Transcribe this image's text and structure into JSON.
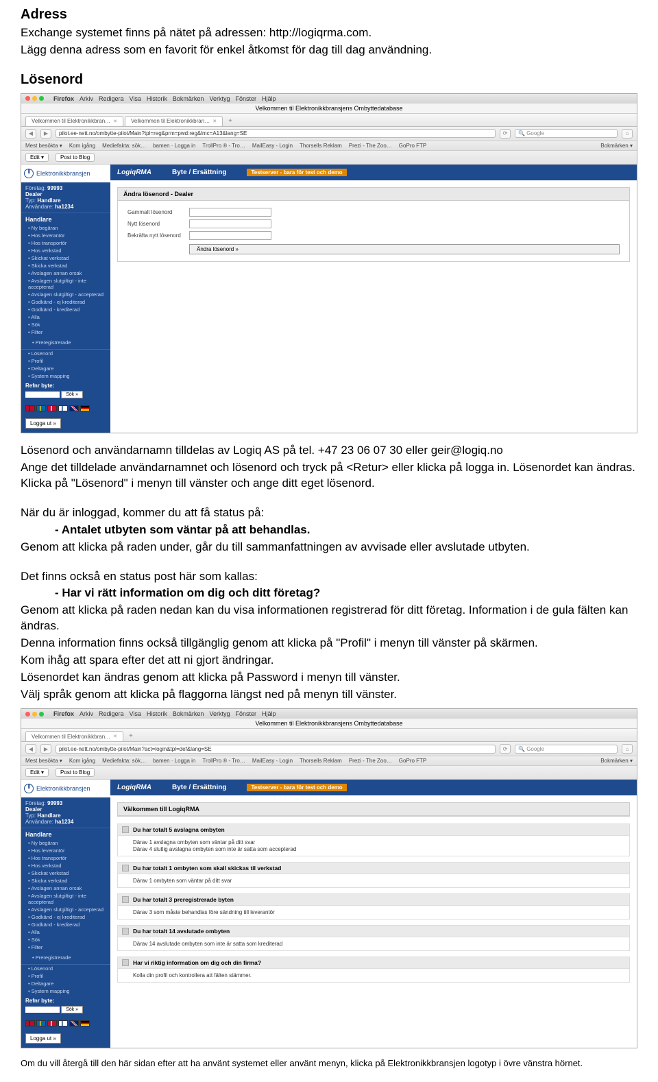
{
  "doc": {
    "adress_title": "Adress",
    "adress_p1": "Exchange systemet finns på nätet på adressen: http://logiqrma.com.",
    "adress_p2": "Lägg denna adress som en favorit för enkel åtkomst för dag till dag användning.",
    "losenord_title": "Lösenord",
    "middle_p1": "Lösenord och användarnamn tilldelas av Logiq AS på tel. +47 23 06 07 30 eller geir@logiq.no",
    "middle_p2": "Ange det tilldelade användarnamnet och lösenord och tryck på  <Retur>  eller klicka på logga in. Lösenordet kan ändras. Klicka på \"Lösenord\" i menyn till vänster och ange ditt eget lösenord.",
    "middle_p3": "När du är inloggad, kommer du att få status på:",
    "middle_b1": "- Antalet utbyten som väntar på att behandlas.",
    "middle_p4": "Genom att klicka på raden under, går du till sammanfattningen av avvisade eller avslutade utbyten.",
    "middle_p5": "Det finns också en status post här som kallas:",
    "middle_b2": "- Har vi rätt information om dig och ditt företag?",
    "middle_p6": "Genom att klicka på raden nedan kan du visa informationen registrerad för ditt företag. Information i de gula fälten kan ändras.",
    "middle_p7": "Denna information finns också tillgänglig genom att klicka på \"Profil\" i menyn till vänster på skärmen.",
    "middle_p8": "Kom ihåg att spara efter det att ni gjort ändringar.",
    "middle_p9": "Lösenordet kan ändras genom att klicka på Password i menyn till vänster.",
    "middle_p10": "Välj språk genom att klicka på flaggorna längst ned på menyn till vänster.",
    "footnote": "Om du vill återgå till den här sidan efter att ha använt systemet eller använt menyn, klicka på Elektronikkbransjen logotyp i övre vänstra hörnet."
  },
  "browser": {
    "app_name": "Firefox",
    "menu": [
      "Arkiv",
      "Redigera",
      "Visa",
      "Historik",
      "Bokmärken",
      "Verktyg",
      "Fönster",
      "Hjälp"
    ],
    "window_title": "Velkommen til Elektronikkbransjens Ombyttedatabase",
    "tab1": "Velkommen til Elektronikkbran…",
    "tab2": "Velkommen til Elektronikkbran…",
    "url1": "pilot.ee-nett.no/ombytte-pilot/Main?tpl=reg&prm=pwd:reg&lmc=A13&lang=SE",
    "url2": "pilot.ee-nett.no/ombytte-pilot/Main?act=login&tpl=def&lang=SE",
    "search_placeholder": "Google",
    "bookmarks": [
      "Mest besökta ▾",
      "Kom igång",
      "Mediefakta: sök…",
      "bamen · Logga in",
      "TrollPro ® - Tro…",
      "MailEasy - Login",
      "Thorsells Reklam",
      "Prezi - The Zoo…",
      "GoPro FTP"
    ],
    "bookmark_right": "Bokmärken ▾",
    "edit": "Edit ▾",
    "post_to_blog": "Post to Blog"
  },
  "app": {
    "logo_text": "Elektronikkbransjen",
    "brand": "LogiqRMA",
    "nav": "Byte / Ersättning",
    "test_banner": "Testserver - bara för test och demo",
    "sidebar": {
      "company_label": "Företag:",
      "company_value": "99993",
      "dealer_label": "Dealer",
      "type_label": "Typ:",
      "type_value": "Handlare",
      "user_label": "Användare:",
      "user_value": "ha1234",
      "section_handlare": "Handlare",
      "items": [
        "Ny begäran",
        "Hos leverantör",
        "Hos transportör",
        "Hos verkstad",
        "Skickat verkstad",
        "Skicka verkstad",
        "Avslagen annan orsak",
        "Avslagen slutgiltigt - inte accepterad",
        "Avslagen slutgiltigt - accepterad",
        "Godkänd - ej krediterad",
        "Godkänd - krediterad",
        "Alla",
        "Sök",
        "Filter"
      ],
      "preregistered": "Preregistrerade",
      "items2": [
        "Lösenord",
        "Profil",
        "Deltagare",
        "System mapping"
      ],
      "refnr_label": "Refnr byte:",
      "sok_btn": "Sök »",
      "logout": "Logga ut »"
    },
    "panel1": {
      "title": "Ändra lösenord - Dealer",
      "old_pwd": "Gammalt lösenord",
      "new_pwd": "Nytt lösenord",
      "confirm_pwd": "Bekräfta nytt lösenord",
      "save_btn": "Ändra lösenord »"
    },
    "panel2": {
      "title": "Välkommen till LogiqRMA",
      "statuses": [
        {
          "header": "Du har totalt 5 avslagna ombyten",
          "lines": [
            "Därav 1 avslagna ombyten som väntar på ditt svar",
            "Därav 4 slutlig avslagna ombyten som inte är satta som accepterad"
          ]
        },
        {
          "header": "Du har totalt 1 ombyten som skall skickas til verkstad",
          "lines": [
            "Därav 1 ombyten som väntar på ditt svar"
          ]
        },
        {
          "header": "Du har totalt 3 preregistrerade byten",
          "lines": [
            "Därav 3 som måste behandlas före sändning till leverantör"
          ]
        },
        {
          "header": "Du har totalt 14 avslutade ombyten",
          "lines": [
            "Därav 14 avslutade ombyten som inte är satta som krediterad"
          ]
        },
        {
          "header": "Har vi riktig information om dig och din firma?",
          "lines": [
            "Kolla din profil och kontrollera att fälten stämmer."
          ]
        }
      ]
    }
  }
}
